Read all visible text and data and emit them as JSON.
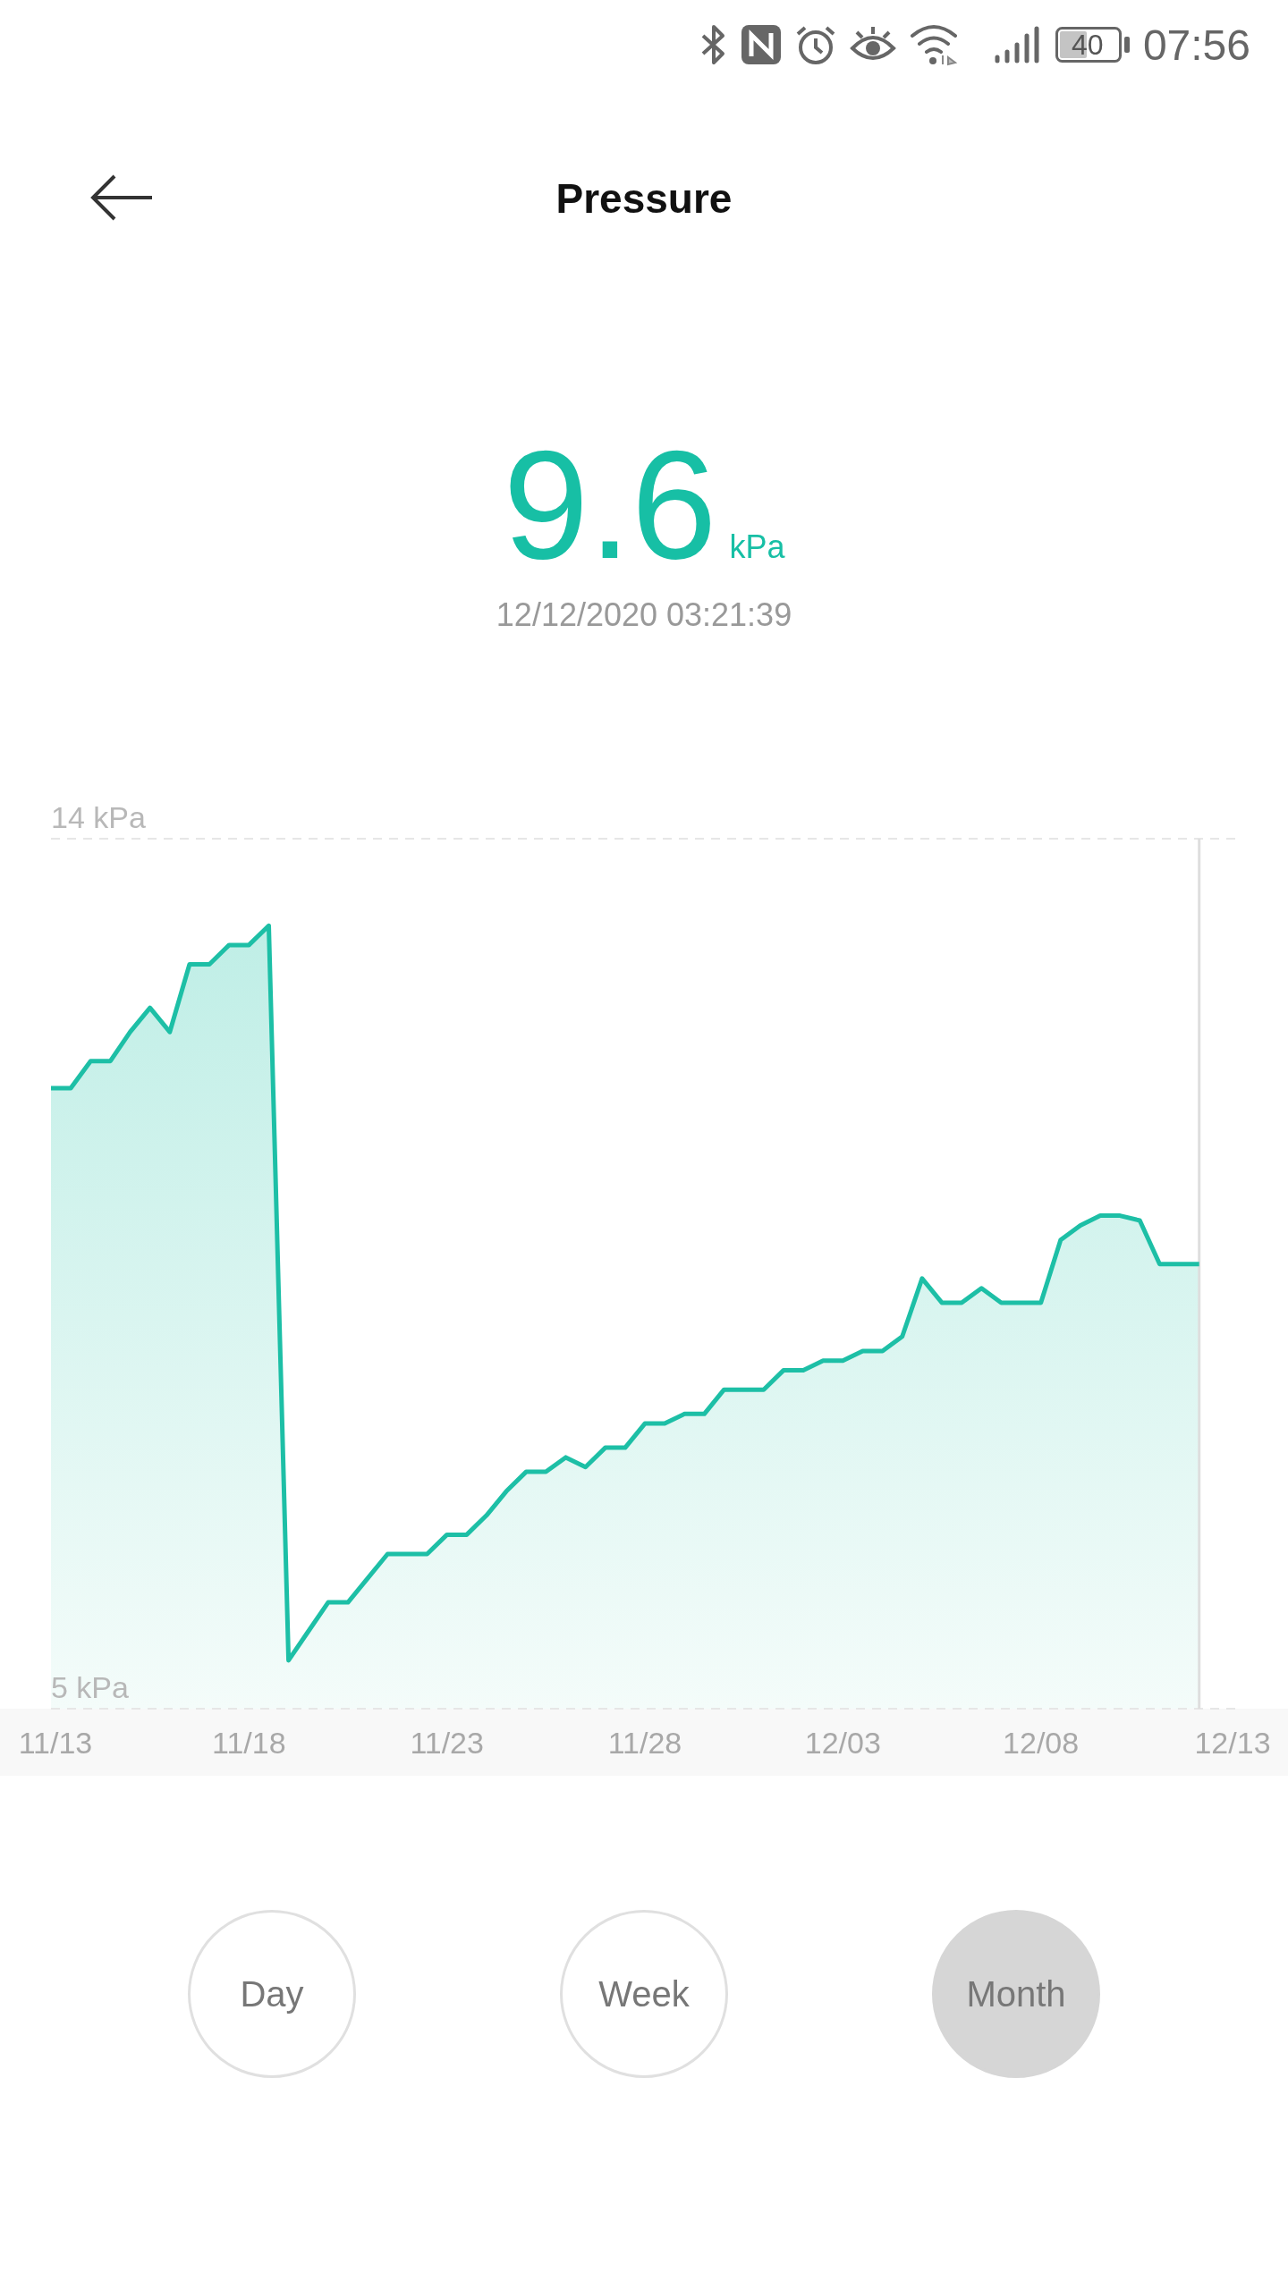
{
  "status_bar": {
    "battery": "40",
    "time": "07:56"
  },
  "header": {
    "title": "Pressure"
  },
  "reading": {
    "value": "9.6",
    "unit": "kPa",
    "timestamp": "12/12/2020 03:21:39"
  },
  "chart": {
    "chart_data": {
      "type": "area",
      "ylim": [
        5,
        14
      ],
      "yticks": [
        {
          "value": 14,
          "label": "14 kPa"
        },
        {
          "value": 5,
          "label": "5 kPa"
        }
      ],
      "categories": [
        "11/13",
        null,
        null,
        null,
        null,
        null,
        null,
        null,
        null,
        null,
        "11/18",
        null,
        null,
        null,
        null,
        null,
        null,
        null,
        null,
        null,
        "11/23",
        null,
        null,
        null,
        null,
        null,
        null,
        null,
        null,
        null,
        "11/28",
        null,
        null,
        null,
        null,
        null,
        null,
        null,
        null,
        null,
        "12/03",
        null,
        null,
        null,
        null,
        null,
        null,
        null,
        null,
        null,
        "12/08",
        null,
        null,
        null,
        null,
        null,
        null,
        null,
        null,
        null,
        "12/13"
      ],
      "series": [
        {
          "color": "#1dbfa6",
          "values": [
            11.42,
            11.42,
            11.7,
            11.7,
            12.0,
            12.25,
            12.0,
            12.7,
            12.7,
            12.9,
            12.9,
            13.1,
            5.5,
            5.8,
            6.1,
            6.1,
            6.35,
            6.6,
            6.6,
            6.6,
            6.8,
            6.8,
            7.0,
            7.25,
            7.45,
            7.45,
            7.6,
            7.5,
            7.7,
            7.7,
            7.95,
            7.95,
            8.05,
            8.05,
            8.3,
            8.3,
            8.3,
            8.5,
            8.5,
            8.6,
            8.6,
            8.7,
            8.7,
            8.85,
            9.45,
            9.2,
            9.2,
            9.35,
            9.2,
            9.2,
            9.2,
            9.85,
            10.0,
            10.1,
            10.1,
            10.05,
            9.6,
            9.6,
            9.6,
            null,
            null
          ]
        }
      ]
    }
  },
  "ranges": [
    {
      "label": "Day",
      "selected": false
    },
    {
      "label": "Week",
      "selected": false
    },
    {
      "label": "Month",
      "selected": true
    }
  ]
}
